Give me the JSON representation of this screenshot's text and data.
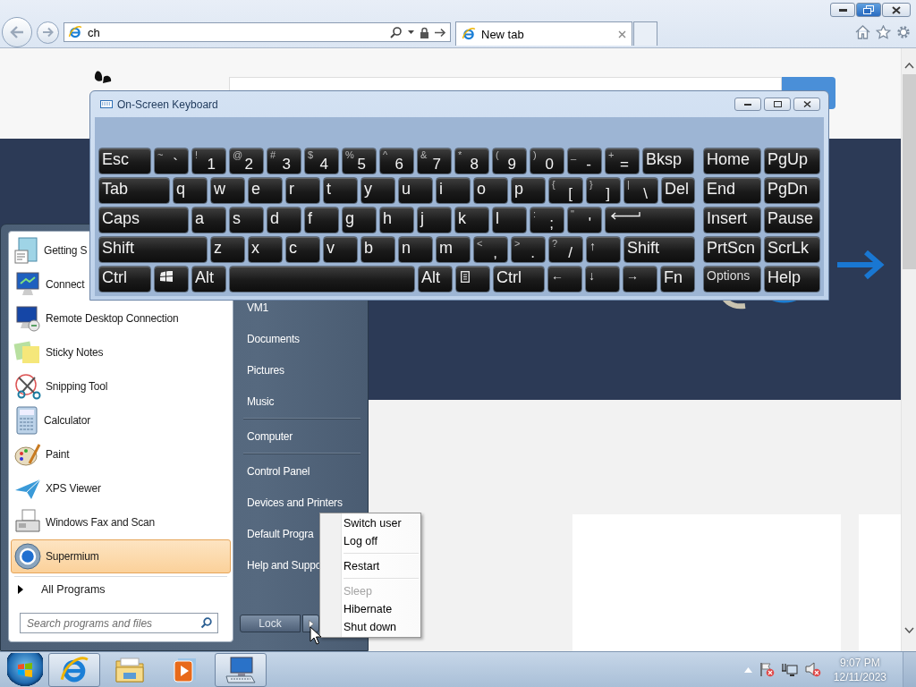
{
  "browser": {
    "address": {
      "value": "ch"
    },
    "tabs": [
      {
        "label": "New tab",
        "selected": true
      }
    ]
  },
  "keyboard": {
    "title": "On-Screen Keyboard",
    "rows": [
      {
        "keys": [
          {
            "kind": "label",
            "label": "Esc"
          },
          {
            "kind": "char",
            "shift": "~",
            "main": "`"
          },
          {
            "kind": "char",
            "shift": "!",
            "main": "1"
          },
          {
            "kind": "char",
            "shift": "@",
            "main": "2"
          },
          {
            "kind": "char",
            "shift": "#",
            "main": "3"
          },
          {
            "kind": "char",
            "shift": "$",
            "main": "4"
          },
          {
            "kind": "char",
            "shift": "%",
            "main": "5"
          },
          {
            "kind": "char",
            "shift": "^",
            "main": "6"
          },
          {
            "kind": "char",
            "shift": "&",
            "main": "7"
          },
          {
            "kind": "char",
            "shift": "*",
            "main": "8"
          },
          {
            "kind": "char",
            "shift": "(",
            "main": "9"
          },
          {
            "kind": "char",
            "shift": ")",
            "main": "0"
          },
          {
            "kind": "char",
            "shift": "_",
            "main": "-"
          },
          {
            "kind": "char",
            "shift": "+",
            "main": "="
          },
          {
            "kind": "label",
            "label": "Bksp"
          }
        ]
      },
      {
        "keys": [
          {
            "kind": "label",
            "label": "Tab"
          },
          {
            "kind": "label",
            "label": "q"
          },
          {
            "kind": "label",
            "label": "w"
          },
          {
            "kind": "label",
            "label": "e"
          },
          {
            "kind": "label",
            "label": "r"
          },
          {
            "kind": "label",
            "label": "t"
          },
          {
            "kind": "label",
            "label": "y"
          },
          {
            "kind": "label",
            "label": "u"
          },
          {
            "kind": "label",
            "label": "i"
          },
          {
            "kind": "label",
            "label": "o"
          },
          {
            "kind": "label",
            "label": "p"
          },
          {
            "kind": "char",
            "shift": "{",
            "main": "["
          },
          {
            "kind": "char",
            "shift": "}",
            "main": "]"
          },
          {
            "kind": "char",
            "shift": "|",
            "main": "\\"
          },
          {
            "kind": "label",
            "label": "Del"
          }
        ]
      },
      {
        "keys": [
          {
            "kind": "label",
            "label": "Caps"
          },
          {
            "kind": "label",
            "label": "a"
          },
          {
            "kind": "label",
            "label": "s"
          },
          {
            "kind": "label",
            "label": "d"
          },
          {
            "kind": "label",
            "label": "f"
          },
          {
            "kind": "label",
            "label": "g"
          },
          {
            "kind": "label",
            "label": "h"
          },
          {
            "kind": "label",
            "label": "j"
          },
          {
            "kind": "label",
            "label": "k"
          },
          {
            "kind": "label",
            "label": "l"
          },
          {
            "kind": "char",
            "shift": ":",
            "main": ";"
          },
          {
            "kind": "char",
            "shift": "\"",
            "main": "'"
          },
          {
            "kind": "enter"
          }
        ]
      },
      {
        "keys": [
          {
            "kind": "label",
            "label": "Shift"
          },
          {
            "kind": "label",
            "label": "z"
          },
          {
            "kind": "label",
            "label": "x"
          },
          {
            "kind": "label",
            "label": "c"
          },
          {
            "kind": "label",
            "label": "v"
          },
          {
            "kind": "label",
            "label": "b"
          },
          {
            "kind": "label",
            "label": "n"
          },
          {
            "kind": "label",
            "label": "m"
          },
          {
            "kind": "char",
            "shift": "<",
            "main": ","
          },
          {
            "kind": "char",
            "shift": ">",
            "main": "."
          },
          {
            "kind": "char",
            "shift": "?",
            "main": "/"
          },
          {
            "kind": "small",
            "label": "↑"
          },
          {
            "kind": "label",
            "label": "Shift"
          }
        ]
      },
      {
        "keys": [
          {
            "kind": "label",
            "label": "Ctrl"
          },
          {
            "kind": "windows"
          },
          {
            "kind": "label",
            "label": "Alt"
          },
          {
            "kind": "space"
          },
          {
            "kind": "label",
            "label": "Alt"
          },
          {
            "kind": "menu"
          },
          {
            "kind": "label",
            "label": "Ctrl"
          },
          {
            "kind": "small",
            "label": "←"
          },
          {
            "kind": "small",
            "label": "↓"
          },
          {
            "kind": "small",
            "label": "→"
          },
          {
            "kind": "label",
            "label": "Fn"
          }
        ]
      }
    ],
    "side_rows": [
      {
        "keys": [
          {
            "kind": "label",
            "label": "Home"
          },
          {
            "kind": "label",
            "label": "PgUp"
          }
        ]
      },
      {
        "keys": [
          {
            "kind": "label",
            "label": "End"
          },
          {
            "kind": "label",
            "label": "PgDn"
          }
        ]
      },
      {
        "keys": [
          {
            "kind": "label",
            "label": "Insert"
          },
          {
            "kind": "label",
            "label": "Pause"
          }
        ]
      },
      {
        "keys": [
          {
            "kind": "label",
            "label": "PrtScn"
          },
          {
            "kind": "label",
            "label": "ScrLk"
          }
        ]
      },
      {
        "keys": [
          {
            "kind": "small",
            "label": "Options"
          },
          {
            "kind": "label",
            "label": "Help"
          }
        ]
      }
    ]
  },
  "start_menu": {
    "programs": [
      {
        "label": "Getting S",
        "selected": false
      },
      {
        "label": "Connect",
        "selected": false
      },
      {
        "label": "Remote Desktop Connection",
        "selected": false
      },
      {
        "label": "Sticky Notes",
        "selected": false
      },
      {
        "label": "Snipping Tool",
        "selected": false
      },
      {
        "label": "Calculator",
        "selected": false
      },
      {
        "label": "Paint",
        "selected": false
      },
      {
        "label": "XPS Viewer",
        "selected": false
      },
      {
        "label": "Windows Fax and Scan",
        "selected": false
      },
      {
        "label": "Supermium",
        "selected": true
      }
    ],
    "all_programs": "All Programs",
    "search": {
      "placeholder": "Search programs and files"
    },
    "places": [
      {
        "kind": "link",
        "label": "VM1"
      },
      {
        "kind": "link",
        "label": "Documents"
      },
      {
        "kind": "link",
        "label": "Pictures"
      },
      {
        "kind": "link",
        "label": "Music"
      },
      {
        "kind": "separator"
      },
      {
        "kind": "link",
        "label": "Computer"
      },
      {
        "kind": "separator"
      },
      {
        "kind": "link",
        "label": "Control Panel"
      },
      {
        "kind": "link",
        "label": "Devices and Printers"
      },
      {
        "kind": "link",
        "label": "Default Progra"
      },
      {
        "kind": "link",
        "label": "Help and Suppo"
      }
    ],
    "lock_button": "Lock"
  },
  "power_menu": {
    "items": [
      {
        "kind": "item",
        "label": "Switch user",
        "disabled": false
      },
      {
        "kind": "item",
        "label": "Log off",
        "disabled": false
      },
      {
        "kind": "separator"
      },
      {
        "kind": "item",
        "label": "Restart",
        "disabled": false
      },
      {
        "kind": "separator"
      },
      {
        "kind": "item",
        "label": "Sleep",
        "disabled": true
      },
      {
        "kind": "item",
        "label": "Hibernate",
        "disabled": false
      },
      {
        "kind": "item",
        "label": "Shut down",
        "disabled": false
      }
    ]
  },
  "taskbar": {
    "apps": [
      {
        "running": true
      },
      {
        "running": false
      },
      {
        "running": false
      },
      {
        "running": true
      }
    ],
    "clock": {
      "time": "9:07 PM",
      "date": "12/11/2023"
    }
  }
}
